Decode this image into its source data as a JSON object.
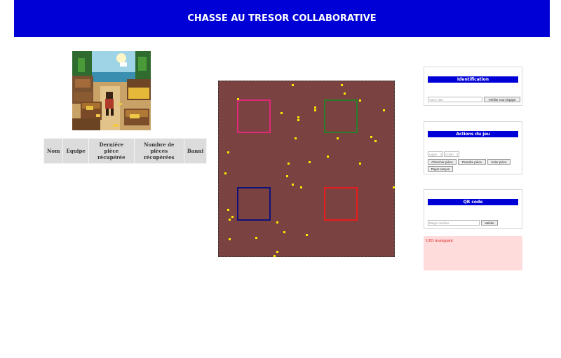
{
  "header": {
    "title": "CHASSE AU TRESOR COLLABORATIVE"
  },
  "illustration": {
    "icon": "treasure-island-picture"
  },
  "players_table": {
    "columns": [
      "Nom",
      "Equipe",
      "Dernière pièce récupérée",
      "Nombre de pièces récupérées",
      "Banni"
    ],
    "rows": []
  },
  "board": {
    "background": "#7a4240",
    "zones": [
      {
        "color": "#e0287a"
      },
      {
        "color": "#2a7d2a"
      },
      {
        "color": "#10107a"
      },
      {
        "color": "#e81c1c"
      }
    ],
    "coin_color": "#ffe600"
  },
  "identification": {
    "title": "Identification",
    "uid_placeholder": "Votre UID",
    "verify_label": "Vérifier mon équipe"
  },
  "game_actions": {
    "title": "Actions du jeu",
    "row_placeholder": "Ligne",
    "col_placeholder": "Colon",
    "buttons": [
      "Chercher pièce",
      "Prendre pièce",
      "Voler pièce",
      "Payer rançon"
    ]
  },
  "qr_code": {
    "title": "QR code",
    "magic_placeholder": "Magic number",
    "validate_label": "Valider"
  },
  "status": {
    "message": "UID manquant",
    "color": "#e22222"
  }
}
